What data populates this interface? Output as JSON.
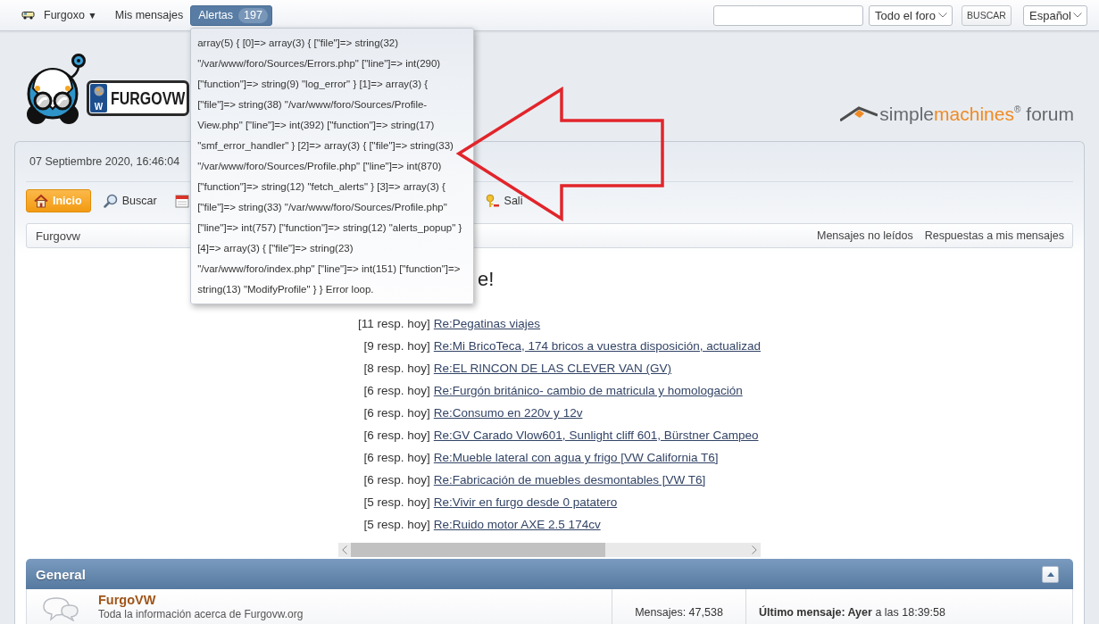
{
  "top_bar": {
    "user_menu": {
      "label": "Furgoxo",
      "caret": "▼"
    },
    "links": [
      "Mis mensajes"
    ],
    "alerts": {
      "label": "Alertas",
      "count": "197",
      "expanded": true,
      "popup_text": "array(5) { [0]=> array(3) { [\"file\"]=> string(32) \"/var/www/foro/Sources/Errors.php\" [\"line\"]=> int(290) [\"function\"]=> string(9) \"log_error\" } [1]=> array(3) { [\"file\"]=> string(38) \"/var/www/foro/Sources/Profile-View.php\" [\"line\"]=> int(392) [\"function\"]=> string(17) \"smf_error_handler\" } [2]=> array(3) { [\"file\"]=> string(33) \"/var/www/foro/Sources/Profile.php\" [\"line\"]=> int(870) [\"function\"]=> string(12) \"fetch_alerts\" } [3]=> array(3) { [\"file\"]=> string(33) \"/var/www/foro/Sources/Profile.php\" [\"line\"]=> int(757) [\"function\"]=> string(12) \"alerts_popup\" } [4]=> array(3) { [\"file\"]=> string(23) \"/var/www/foro/index.php\" [\"line\"]=> int(151) [\"function\"]=> string(13) \"ModifyProfile\" } } Error loop."
    },
    "search": {
      "scope": "Todo el foro",
      "button": "BUSCAR"
    },
    "language": "Español"
  },
  "header": {
    "site_logo": {
      "plate_letter": "W",
      "text": "FURGOVW"
    },
    "forum_logo": {
      "parts": [
        "simple",
        "machines",
        "®",
        "forum"
      ]
    }
  },
  "date": "07 Septiembre 2020, 16:46:04",
  "nav": [
    {
      "label": "Inicio",
      "selected": true
    },
    {
      "label": "Buscar",
      "selected": false
    },
    {
      "selected": false
    },
    {
      "label": "Sali",
      "selected": false
    }
  ],
  "breadcrumb": {
    "trail": [
      "Furgovw"
    ],
    "links": [
      "Mensajes no leídos",
      "Respuestas a mis mensajes"
    ]
  },
  "recent": {
    "heading": "e!",
    "rows": [
      {
        "count": "[11 resp. hoy]",
        "title": "Re:Pegatinas viajes"
      },
      {
        "count": "[9 resp. hoy]",
        "title": "Re:Mi BricoTeca, 174 bricos a vuestra disposición, actualizad"
      },
      {
        "count": "[8 resp. hoy]",
        "title": "Re:EL RINCON DE LAS CLEVER VAN (GV)"
      },
      {
        "count": "[6 resp. hoy]",
        "title": "Re:Furgón británico- cambio de matricula y homologación"
      },
      {
        "count": "[6 resp. hoy]",
        "title": "Re:Consumo en 220v y 12v"
      },
      {
        "count": "[6 resp. hoy]",
        "title": "Re:GV Carado Vlow601, Sunlight cliff 601, Bürstner Campeo"
      },
      {
        "count": "[6 resp. hoy]",
        "title": "Re:Mueble lateral con agua y frigo [VW California T6]"
      },
      {
        "count": "[6 resp. hoy]",
        "title": "Re:Fabricación de muebles desmontables [VW T6]"
      },
      {
        "count": "[5 resp. hoy]",
        "title": "Re:Vivir en furgo desde 0 patatero"
      },
      {
        "count": "[5 resp. hoy]",
        "title": "Re:Ruido motor AXE 2.5 174cv"
      }
    ]
  },
  "categories": [
    {
      "title": "General",
      "expanded": true,
      "boards": [
        {
          "name": "FurgoVW",
          "description": "Toda la información acerca de Furgovw.org",
          "stats": "Mensajes: 47,538",
          "last_post": "**Último mensaje: Ayer** a las 18:39:58"
        }
      ]
    }
  ]
}
